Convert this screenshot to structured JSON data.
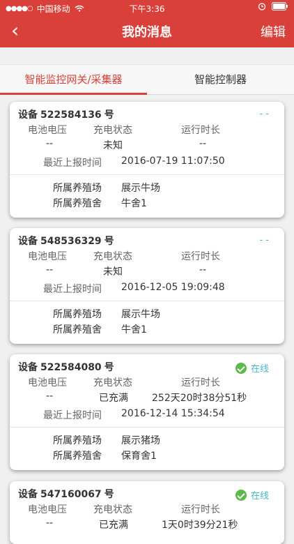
{
  "statusbar": {
    "carrier": "中国移动",
    "time": "下午3:36"
  },
  "nav": {
    "back": "‹",
    "title": "我的消息",
    "edit": "编辑"
  },
  "tabs": [
    {
      "label": "智能监控网关/采集器"
    },
    {
      "label": "智能控制器"
    }
  ],
  "labels": {
    "device_prefix": "设备",
    "device_suffix": "号",
    "battery": "电池电压",
    "charge": "充电状态",
    "runtime": "运行时长",
    "last_report": "最近上报时间",
    "farm": "所属养殖场",
    "barn": "所属养殖舍"
  },
  "cards": [
    {
      "device": "522584136",
      "status": "- -",
      "battery": "--",
      "charge": "未知",
      "runtime": "--",
      "last_report": "2016-07-19 11:07:50",
      "farm": "展示牛场",
      "barn": "牛舍1"
    },
    {
      "device": "548536329",
      "status": "- -",
      "battery": "--",
      "charge": "未知",
      "runtime": "--",
      "last_report": "2016-12-05 19:09:48",
      "farm": "展示牛场",
      "barn": "牛舍1"
    },
    {
      "device": "522584080",
      "status": "在线",
      "battery": "--",
      "charge": "已充满",
      "runtime": "252天20时38分51秒",
      "last_report": "2016-12-14 15:34:54",
      "farm": "展示猪场",
      "barn": "保育舍1"
    },
    {
      "device": "547160067",
      "status": "在线",
      "battery": "--",
      "charge": "已充满",
      "runtime": "1天0时39分21秒",
      "last_report": "",
      "farm": "",
      "barn": ""
    }
  ]
}
